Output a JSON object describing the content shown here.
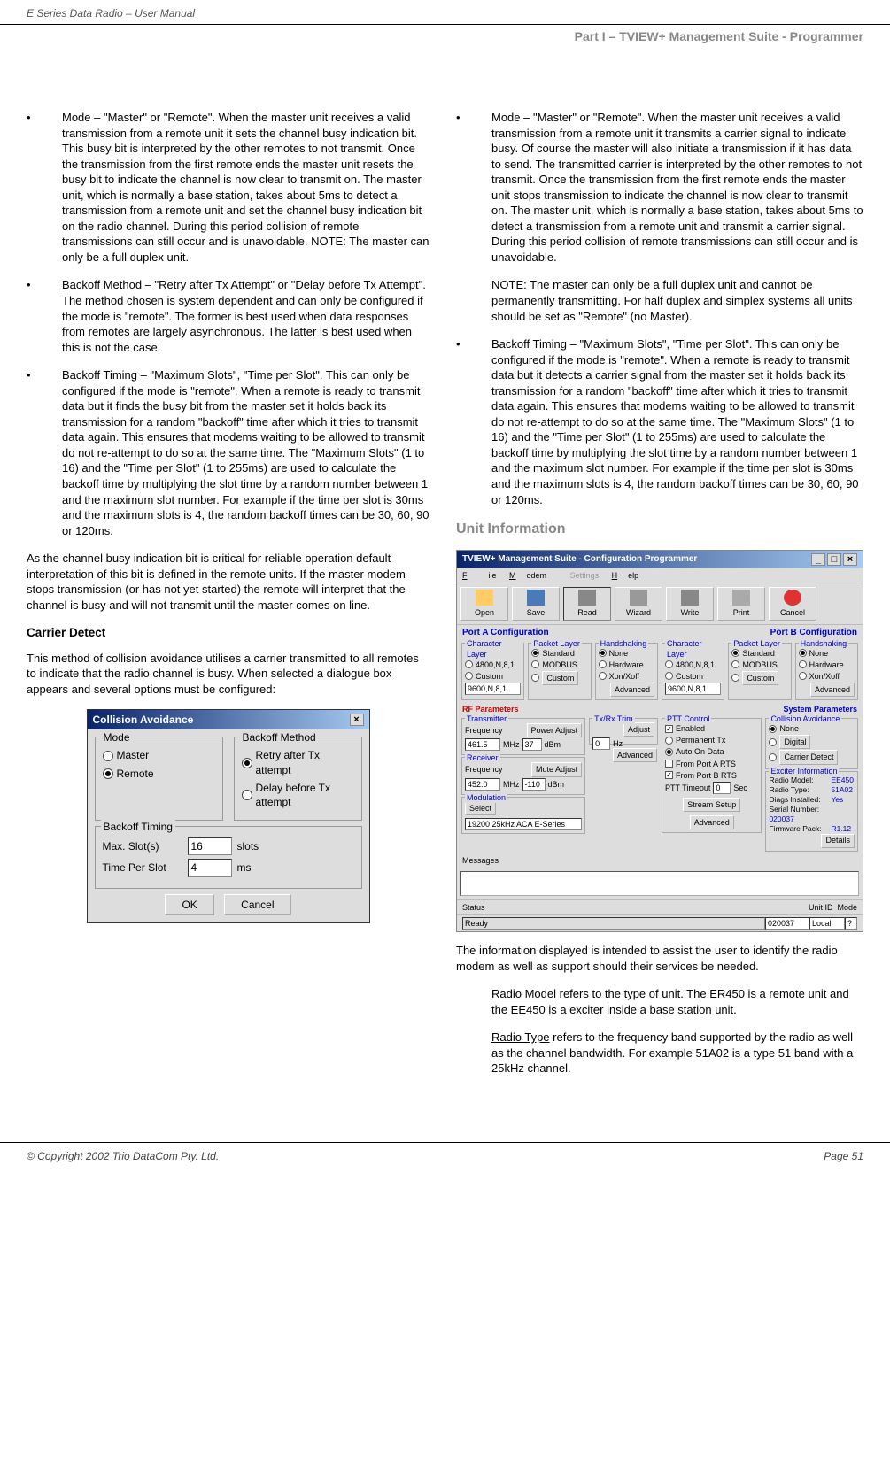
{
  "header": {
    "title": "E Series Data Radio – User Manual",
    "subtitle": "Part I – TVIEW+ Management Suite - Programmer"
  },
  "left": {
    "b1": "Mode – \"Master\" or \"Remote\". When the master unit receives a valid transmission from a remote unit it sets the channel busy indication bit. This busy bit is interpreted by the other remotes to not transmit. Once the transmission from the first remote ends the master unit resets the busy bit to indicate the channel is now clear to transmit on. The master unit, which is normally a base station, takes about 5ms to detect a transmission from a remote unit and set the channel busy indication bit on the radio channel. During this period collision of remote transmissions can still occur and is unavoidable. NOTE: The master can only be a full duplex unit.",
    "b2": "Backoff Method – \"Retry after Tx Attempt\" or \"Delay before Tx Attempt\". The method chosen is system dependent and can only be configured if the mode is \"remote\". The former is best used when data responses from remotes are largely asynchronous. The latter is best used when this is not the case.",
    "b3": "Backoff Timing – \"Maximum Slots\", \"Time per Slot\". This can only be configured if the mode is \"remote\". When a remote is ready to transmit data but it finds the busy bit from the master set it holds back its transmission for a random \"backoff\" time after which it tries to transmit data again. This ensures that modems waiting to be allowed to transmit do not re-attempt to do so at the same time. The \"Maximum Slots\" (1 to 16) and the \"Time per Slot\" (1 to 255ms) are used to calculate the backoff time by multiplying the slot time by a random number between 1 and the maximum slot number. For example if the time per slot is 30ms and the maximum slots is 4, the random backoff times can be 30, 60, 90 or 120ms.",
    "p1": "As the channel busy indication bit is critical for reliable operation default interpretation of this bit is defined in the remote units. If the master modem stops transmission (or has not yet started) the remote will interpret that the channel is busy and will not transmit until the master comes on line.",
    "h1": "Carrier Detect",
    "p2": "This method of collision avoidance utilises a carrier transmitted to all remotes to indicate that the radio channel is busy. When selected a dialogue box appears and several options must be configured:"
  },
  "dlg": {
    "title": "Collision Avoidance",
    "mode": "Mode",
    "master": "Master",
    "remote": "Remote",
    "backoff_method": "Backoff Method",
    "retry": "Retry after Tx attempt",
    "delay": "Delay before Tx attempt",
    "backoff_timing": "Backoff Timing",
    "maxslots_lbl": "Max. Slot(s)",
    "maxslots_val": "16",
    "slots_unit": "slots",
    "tps_lbl": "Time Per Slot",
    "tps_val": "4",
    "tps_unit": "ms",
    "ok": "OK",
    "cancel": "Cancel"
  },
  "right": {
    "b1": "Mode – \"Master\" or \"Remote\". When the master unit receives a valid transmission from a remote unit it transmits a carrier signal to indicate busy. Of course the master will also initiate a transmission if it has data to send. The transmitted carrier is interpreted by the other remotes to not transmit. Once the transmission from the first remote ends the master unit stops transmission to indicate the channel is now clear to transmit on. The master unit, which is normally a base station, takes about 5ms to detect a transmission from a remote unit and transmit a carrier signal. During this period collision of remote transmissions can still occur and is unavoidable.",
    "note": "NOTE: The master can only be a full duplex unit and cannot be permanently transmitting. For half duplex and simplex systems all units should be set as \"Remote\" (no Master).",
    "b2": "Backoff Timing – \"Maximum Slots\", \"Time per Slot\". This can only be configured if the mode is \"remote\". When a remote is ready to transmit data but it detects a carrier signal from the master set it holds back its transmission for a random \"backoff\" time after which it tries to transmit data again. This ensures that modems waiting to be allowed to transmit do not re-attempt to do so at the same time. The \"Maximum Slots\" (1 to 16) and the \"Time per Slot\" (1 to 255ms) are used to calculate the backoff time by multiplying the slot time by a random number between 1 and the maximum slot number. For example if the time per slot is 30ms and the maximum slots is 4, the random backoff times can be 30, 60, 90 or 120ms.",
    "h1": "Unit Information",
    "p1": "The information displayed is intended to assist the user to identify the radio modem as well as support should their services be needed.",
    "rm_lbl": "Radio Model",
    "rm_txt": " refers to the type of unit. The ER450 is a remote unit and the EE450 is a exciter inside a base station unit.",
    "rt_lbl": "Radio Type",
    "rt_txt": " refers to the frequency band supported by the radio as well as the channel bandwidth. For example 51A02 is a type 51 band with a 25kHz channel."
  },
  "ss": {
    "title": "TVIEW+ Management Suite - Configuration Programmer",
    "menu": {
      "file": "File",
      "modem": "Modem",
      "settings": "Settings",
      "help": "Help"
    },
    "tb": {
      "open": "Open",
      "save": "Save",
      "read": "Read",
      "wizard": "Wizard",
      "write": "Write",
      "print": "Print",
      "cancel": "Cancel"
    },
    "portA": "Port A Configuration",
    "portB": "Port B Configuration",
    "charlayer": "Character Layer",
    "packetlayer": "Packet Layer",
    "handshaking": "Handshaking",
    "c9600": "9600,N,8,1",
    "c4800": "4800,N,8,1",
    "custom": "Custom",
    "standard": "Standard",
    "modbus": "MODBUS",
    "none": "None",
    "hardware": "Hardware",
    "xonxoff": "Xon/Xoff",
    "advanced": "Advanced",
    "rf": "RF Parameters",
    "sys": "System Parameters",
    "transmitter": "Transmitter",
    "receiver": "Receiver",
    "modulation": "Modulation",
    "freq": "Frequency",
    "mhz": "MHz",
    "dbm": "dBm",
    "hz": "Hz",
    "txf": "461.5",
    "txp": "37",
    "rxf": "452.0",
    "rxp": "-110",
    "poweradjust": "Power Adjust",
    "muteadjust": "Mute Adjust",
    "adjust": "Adjust",
    "txrx": "Tx/Rx Trim",
    "trim": "0",
    "select": "Select",
    "modstr": "19200 25kHz ACA E-Series",
    "ptt": "PTT Control",
    "permtx": "Permanent Tx",
    "auto": "Auto On Data",
    "fparts": "From Port A RTS",
    "fpbrts": "From Port B RTS",
    "ptttimeout": "PTT Timeout",
    "sec": "Sec",
    "ptt_val": "0",
    "stream": "Stream Setup",
    "enabled": "Enabled",
    "collision": "Collision Avoidance",
    "digital": "Digital",
    "carrier": "Carrier Detect",
    "exciter": "Exciter Information",
    "rm": "Radio Model:",
    "rmv": "EE450",
    "rt": "Radio Type:",
    "rtv": "51A02",
    "di": "Diags Installed:",
    "div": "Yes",
    "sn": "Serial Number:",
    "snv": "020037",
    "fp": "Firmware Pack:",
    "fpv": "R1.12",
    "details": "Details",
    "messages": "Messages",
    "status": "Status",
    "ready": "Ready",
    "unitid": "Unit ID",
    "unitid_val": "020037",
    "mode": "Mode",
    "mode_val": "Local"
  },
  "footer": {
    "copy": "© Copyright 2002 Trio DataCom Pty. Ltd.",
    "page": "Page 51"
  }
}
